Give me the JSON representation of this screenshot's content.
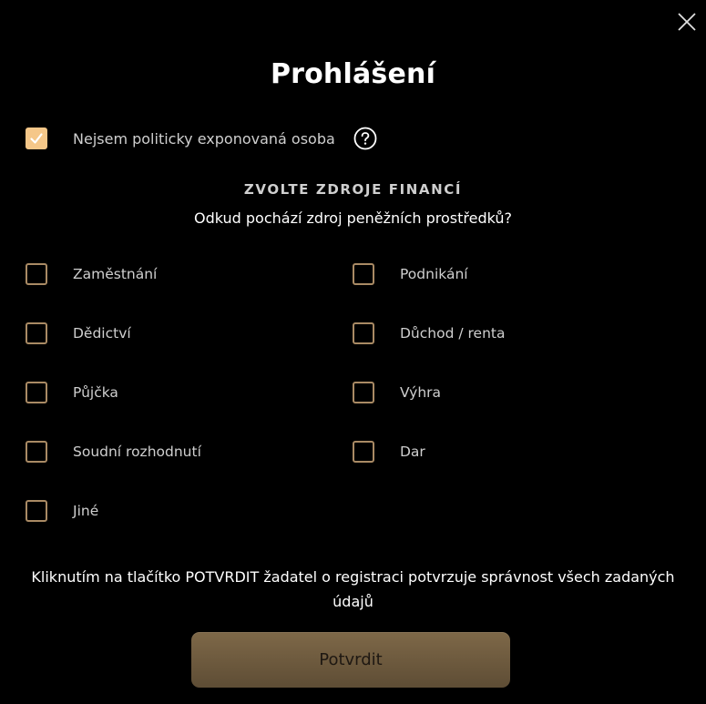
{
  "dialog": {
    "title": "Prohlášení",
    "close_icon": "close-icon"
  },
  "pep": {
    "label": "Nejsem politicky exponovaná osoba",
    "checked": true,
    "help_icon": "question-circle-icon"
  },
  "funds": {
    "heading": "ZVOLTE ZDROJE FINANCÍ",
    "question": "Odkud pochází zdroj peněžních prostředků?",
    "options": [
      {
        "label": "Zaměstnání",
        "checked": false
      },
      {
        "label": "Podnikání",
        "checked": false
      },
      {
        "label": "Dědictví",
        "checked": false
      },
      {
        "label": "Důchod / renta",
        "checked": false
      },
      {
        "label": "Půjčka",
        "checked": false
      },
      {
        "label": "Výhra",
        "checked": false
      },
      {
        "label": "Soudní rozhodnutí",
        "checked": false
      },
      {
        "label": "Dar",
        "checked": false
      },
      {
        "label": "Jiné",
        "checked": false
      }
    ]
  },
  "notice": "Kliknutím na tlačítko POTVRDIT žadatel o registraci potvrzuje správnost všech zadaných údajů",
  "confirm_button": {
    "label": "Potvrdit"
  },
  "colors": {
    "background": "#000000",
    "accent": "#f5c789",
    "checkbox_border": "#a98a64",
    "button": "#6e5a3f"
  }
}
